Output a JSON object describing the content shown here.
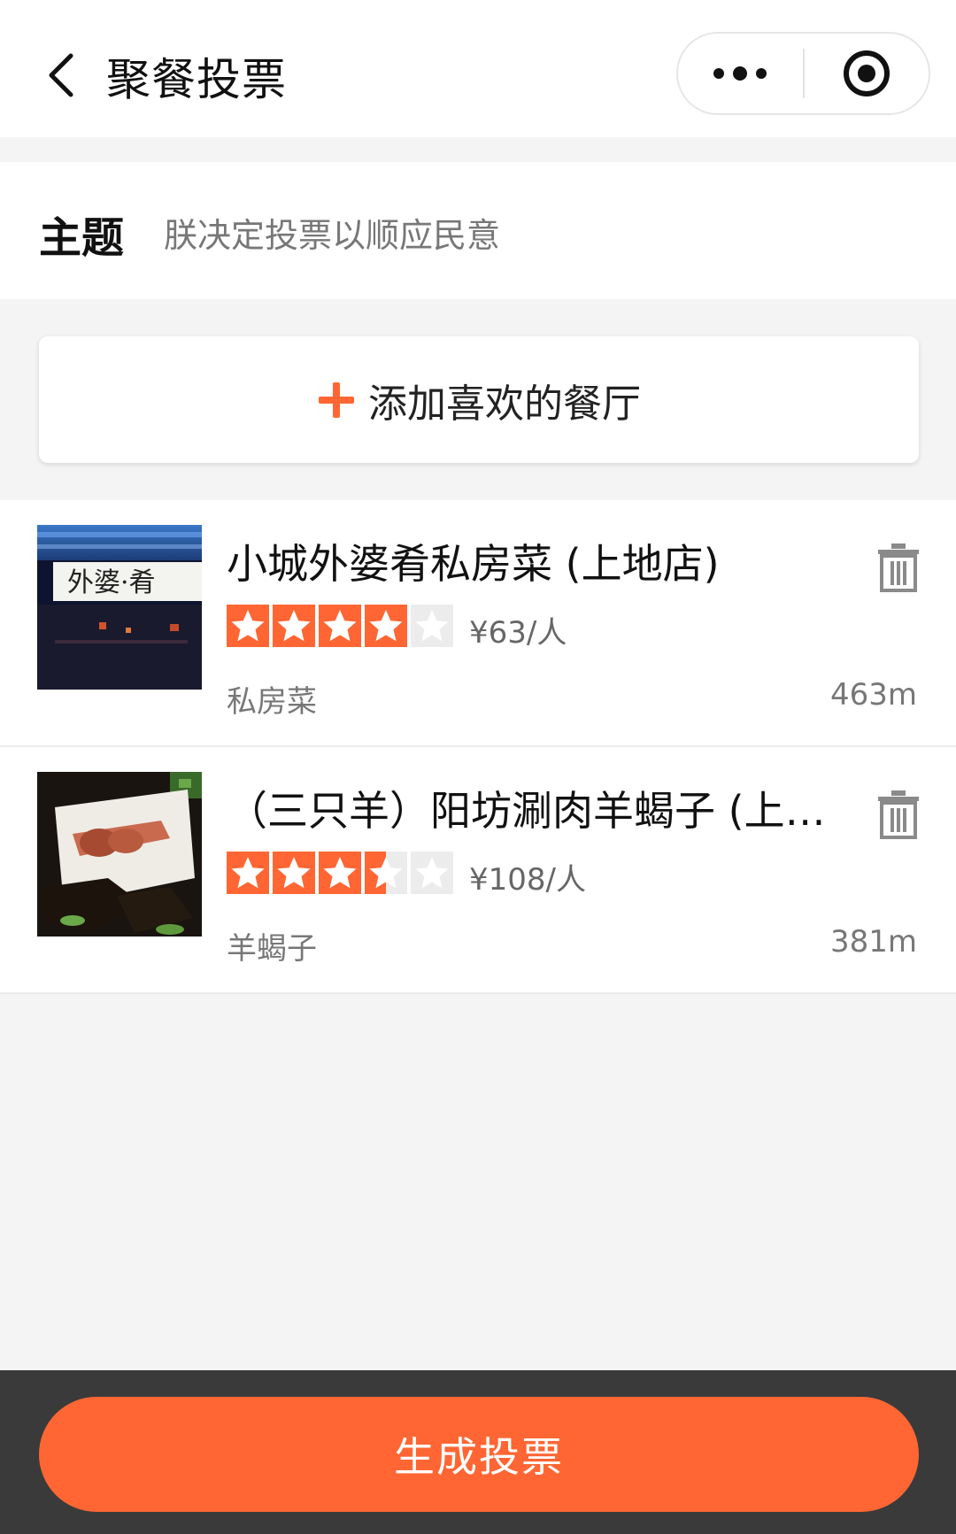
{
  "header": {
    "title": "聚餐投票",
    "back_icon": "chevron-left-icon",
    "more_icon": "more-dots-icon",
    "target_icon": "target-icon"
  },
  "topic": {
    "label": "主题",
    "value": "朕决定投票以顺应民意"
  },
  "add_button": {
    "label": "添加喜欢的餐厅",
    "icon": "plus-icon",
    "accent": "#ff6633"
  },
  "restaurants": [
    {
      "name": "小城外婆肴私房菜 (上地店)",
      "rating": 4,
      "price": "¥63/人",
      "category": "私房菜",
      "distance": "463m",
      "thumb_sign_text": "外婆·肴"
    },
    {
      "name": "（三只羊）阳坊涮肉羊蝎子 (上…",
      "rating": 3.5,
      "price": "¥108/人",
      "category": "羊蝎子",
      "distance": "381m"
    }
  ],
  "bottom": {
    "vote_button": "生成投票"
  },
  "colors": {
    "accent": "#ff6633",
    "star_empty": "#ececec",
    "bottom_bar": "#3a3a3a"
  }
}
